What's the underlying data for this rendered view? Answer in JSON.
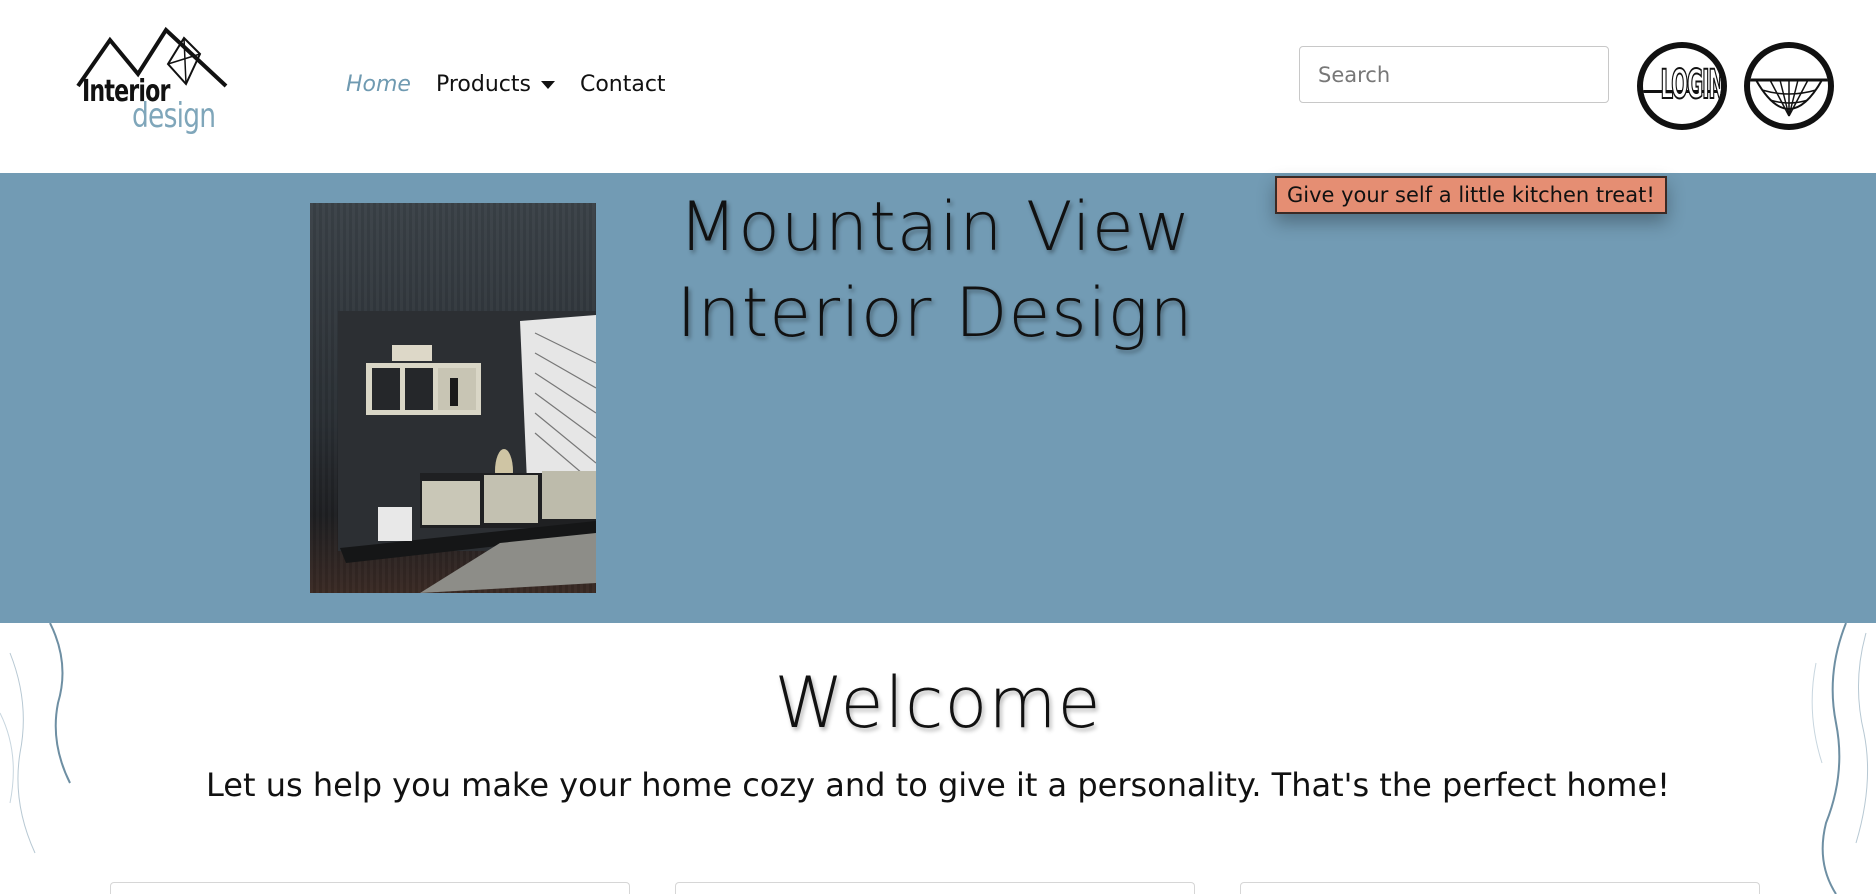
{
  "header": {
    "logo": {
      "line1": "Interior",
      "line2": "design"
    },
    "nav": [
      {
        "label": "Home",
        "active": true
      },
      {
        "label": "Products",
        "dropdown": true
      },
      {
        "label": "Contact"
      }
    ],
    "search": {
      "placeholder": "Search",
      "value": ""
    },
    "login_button": {
      "label": "LOGIN",
      "icon": "login-icon"
    },
    "cart_button": {
      "icon": "basket-icon"
    }
  },
  "tooltip": {
    "text": "Give your self a little kitchen treat!",
    "color": "#e58e73"
  },
  "hero": {
    "title_line1": "Mountain View",
    "title_line2": "Interior Design",
    "background": "#729bb4"
  },
  "welcome": {
    "title": "Welcome",
    "subtitle": "Let us help you make your home cozy and to give it a personality. That's the perfect home!"
  },
  "colors": {
    "accent": "#6f9ab1",
    "tooltip": "#e58e73"
  }
}
